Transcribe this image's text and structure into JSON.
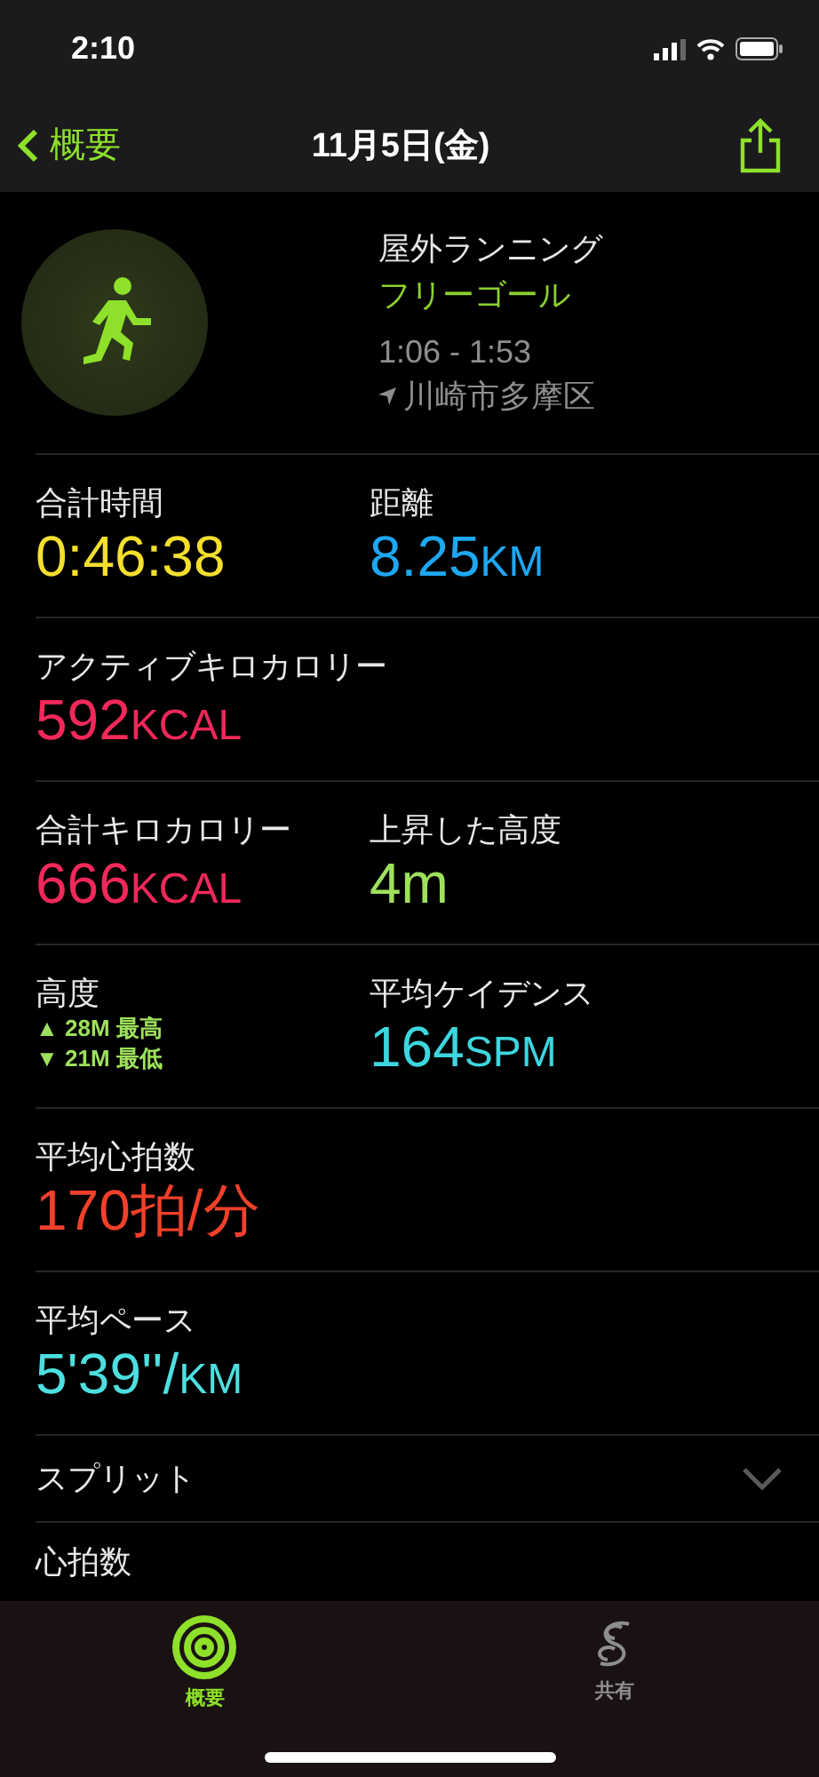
{
  "status_bar": {
    "time": "2:10"
  },
  "nav": {
    "back": "概要",
    "title": "11月5日(金)"
  },
  "workout": {
    "type": "屋外ランニング",
    "goal": "フリーゴール",
    "time_range": "1:06 - 1:53",
    "location": "川崎市多摩区"
  },
  "rows": [
    {
      "cells": [
        {
          "kind": "value",
          "label": "合計時間",
          "value": "0:46:38",
          "color": "#f4df2e"
        },
        {
          "kind": "value",
          "label": "距離",
          "value": "8.25",
          "unit": "KM",
          "color": "#1ea7f2"
        }
      ]
    },
    {
      "cells": [
        {
          "kind": "value",
          "label": "アクティブキロカロリー",
          "value": "592",
          "unit": "KCAL",
          "color": "#f1285a"
        }
      ]
    },
    {
      "cells": [
        {
          "kind": "value",
          "label": "合計キロカロリー",
          "value": "666",
          "unit": "KCAL",
          "color": "#f1285a"
        },
        {
          "kind": "value",
          "label": "上昇した高度",
          "value": "4m",
          "color": "#9ee05c"
        }
      ]
    },
    {
      "cells": [
        {
          "kind": "range",
          "label": "高度",
          "color": "#9ee05c",
          "lines": [
            {
              "arrow": "▲",
              "text": "28M",
              "tag": "最高"
            },
            {
              "arrow": "▼",
              "text": "21M",
              "tag": "最低"
            }
          ]
        },
        {
          "kind": "value",
          "label": "平均ケイデンス",
          "value": "164",
          "unit": "SPM",
          "color": "#3dd6df"
        }
      ]
    },
    {
      "cells": [
        {
          "kind": "value",
          "label": "平均心拍数",
          "value": "170拍/分",
          "color": "#f2402a"
        }
      ]
    },
    {
      "cells": [
        {
          "kind": "value",
          "label": "平均ペース",
          "value": "5'39''/",
          "unit": "KM",
          "color": "#4ddfe0"
        }
      ]
    }
  ],
  "sections": [
    {
      "label": "スプリット",
      "expanded": false
    },
    {
      "label": "心拍数"
    }
  ],
  "tab_bar": [
    {
      "label": "概要",
      "selected": true
    },
    {
      "label": "共有",
      "selected": false
    }
  ]
}
